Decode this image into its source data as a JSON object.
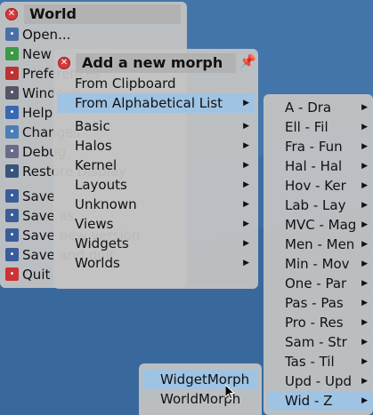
{
  "world_menu": {
    "title": "World",
    "items": [
      {
        "label": "Open...",
        "icon": "folder-icon",
        "color": "#4a6fa5"
      },
      {
        "label": "New",
        "icon": "puzzle-icon",
        "color": "#3a9a4a"
      },
      {
        "label": "Preferences",
        "icon": "preferences-icon",
        "color": "#b33"
      },
      {
        "label": "Windows",
        "icon": "window-icon",
        "color": "#556"
      },
      {
        "label": "Help",
        "icon": "help-icon",
        "color": "#3b67b0"
      },
      {
        "label": "Changes",
        "icon": "changes-icon",
        "color": "#4a7fb5"
      },
      {
        "label": "Debug",
        "icon": "debug-icon",
        "color": "#6a6a8a"
      },
      {
        "label": "Restore Display",
        "icon": "display-icon",
        "color": "#39557a"
      },
      {
        "label": "Save",
        "icon": "save-icon",
        "color": "#3a5d9a"
      },
      {
        "label": "Save as...",
        "icon": "save-as-icon",
        "color": "#3a5d9a"
      },
      {
        "label": "Save new version",
        "icon": "save-version-icon",
        "color": "#3a5d9a"
      },
      {
        "label": "Save and quit",
        "icon": "save-quit-icon",
        "color": "#3a5d9a"
      },
      {
        "label": "Quit",
        "icon": "quit-icon",
        "color": "#c33"
      }
    ]
  },
  "add_menu": {
    "title": "Add a new morph",
    "top_items": [
      "From Clipboard",
      "From Alphabetical List"
    ],
    "categories": [
      "Basic",
      "Halos",
      "Kernel",
      "Layouts",
      "Unknown",
      "Views",
      "Widgets",
      "Worlds"
    ]
  },
  "alpha_menu": {
    "items": [
      "A - Dra",
      "Ell - Fil",
      "Fra - Fun",
      "Hal - Hal",
      "Hov - Ker",
      "Lab - Lay",
      "MVC - Mag",
      "Men - Men",
      "Min - Mov",
      "One - Par",
      "Pas - Pas",
      "Pro - Res",
      "Sam - Str",
      "Tas - Til",
      "Upd - Upd",
      "Wid - Z"
    ]
  },
  "widget_menu": {
    "items": [
      "WidgetMorph",
      "WorldMorph"
    ]
  },
  "colors": {
    "selection": "#9fc3e3",
    "menu_bg": "#c4c4c4",
    "desktop": "#3d6ea3"
  }
}
